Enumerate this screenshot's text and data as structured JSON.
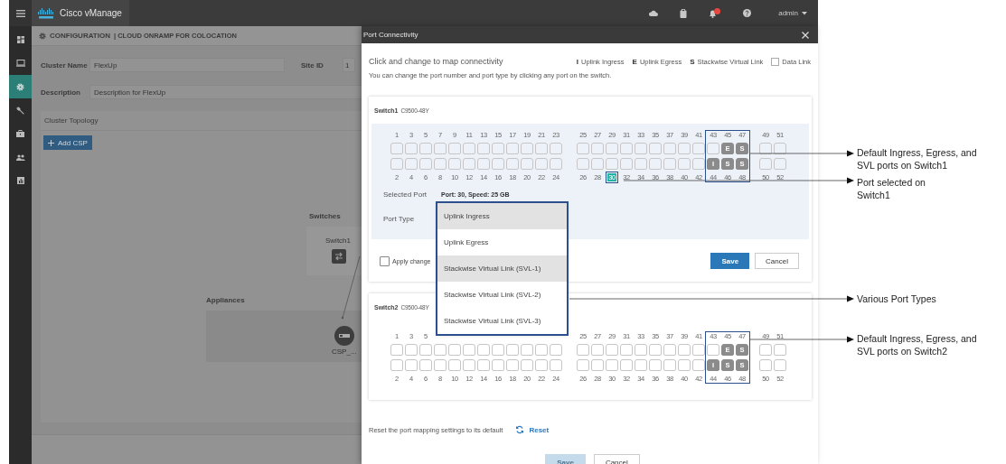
{
  "app": {
    "brand": "Cisco vManage",
    "user": "admin",
    "breadcrumb": {
      "section": "CONFIGURATION",
      "page": "| CLOUD ONRAMP FOR COLOCATION"
    },
    "sidebar": [
      {
        "kind": "dashboard",
        "selected": false
      },
      {
        "kind": "monitor",
        "selected": false
      },
      {
        "kind": "gear",
        "selected": true
      },
      {
        "kind": "wrench",
        "selected": false
      },
      {
        "kind": "toolbox",
        "selected": false
      },
      {
        "kind": "users",
        "selected": false
      },
      {
        "kind": "chart",
        "selected": false
      }
    ],
    "form": {
      "cluster_name_label": "Cluster Name",
      "cluster_name": "FlexUp",
      "site_id_label": "Site ID",
      "site_id": "1",
      "description_label": "Description",
      "description": "Description for FlexUp"
    },
    "topology": {
      "title": "Cluster Topology",
      "add_button": "Add CSP",
      "switches_title": "Switches",
      "switch_node": "Switch1",
      "appliances_title": "Appliances",
      "appliance_node": "CSP_..."
    }
  },
  "modal": {
    "title": "Port Connectivity",
    "heading": "Click and change to map connectivity",
    "hint": "You can change the port number and port type by clicking any port on the switch.",
    "legend": [
      {
        "kind": "ingress",
        "letter": "I",
        "label": "Uplink Ingress"
      },
      {
        "kind": "egress",
        "letter": "E",
        "label": "Uplink Egress"
      },
      {
        "kind": "svl",
        "letter": "S",
        "label": "Stackwise Virtual Link"
      },
      {
        "kind": "data",
        "label": "Data Link"
      }
    ],
    "switches": [
      {
        "name": "Switch1",
        "model": "C9500-48Y",
        "selected": true,
        "sections": [
          {
            "highlighted": false,
            "ports": [
              {
                "number": "1",
                "kind": "data",
                "selected": false
              },
              {
                "number": "2",
                "kind": "data",
                "selected": false
              },
              {
                "number": "3",
                "kind": "data",
                "selected": false
              },
              {
                "number": "4",
                "kind": "data",
                "selected": false
              },
              {
                "number": "5",
                "kind": "data",
                "selected": false
              },
              {
                "number": "6",
                "kind": "data",
                "selected": false
              },
              {
                "number": "7",
                "kind": "data",
                "selected": false
              },
              {
                "number": "8",
                "kind": "data",
                "selected": false
              },
              {
                "number": "9",
                "kind": "data",
                "selected": false
              },
              {
                "number": "10",
                "kind": "data",
                "selected": false
              },
              {
                "number": "11",
                "kind": "data",
                "selected": false
              },
              {
                "number": "12",
                "kind": "data",
                "selected": false
              },
              {
                "number": "13",
                "kind": "data",
                "selected": false
              },
              {
                "number": "14",
                "kind": "data",
                "selected": false
              },
              {
                "number": "15",
                "kind": "data",
                "selected": false
              },
              {
                "number": "16",
                "kind": "data",
                "selected": false
              },
              {
                "number": "17",
                "kind": "data",
                "selected": false
              },
              {
                "number": "18",
                "kind": "data",
                "selected": false
              },
              {
                "number": "19",
                "kind": "data",
                "selected": false
              },
              {
                "number": "20",
                "kind": "data",
                "selected": false
              },
              {
                "number": "21",
                "kind": "data",
                "selected": false
              },
              {
                "number": "22",
                "kind": "data",
                "selected": false
              },
              {
                "number": "23",
                "kind": "data",
                "selected": false
              },
              {
                "number": "24",
                "kind": "data",
                "selected": false
              }
            ]
          },
          {
            "highlighted": false,
            "ports": [
              {
                "number": "25",
                "kind": "data",
                "selected": false
              },
              {
                "number": "26",
                "kind": "data",
                "selected": false
              },
              {
                "number": "27",
                "kind": "data",
                "selected": false
              },
              {
                "number": "28",
                "kind": "data",
                "selected": false
              },
              {
                "number": "29",
                "kind": "data",
                "selected": false
              },
              {
                "number": "30",
                "kind": "data",
                "selected": true
              },
              {
                "number": "31",
                "kind": "data",
                "selected": false
              },
              {
                "number": "32",
                "kind": "data",
                "selected": false
              },
              {
                "number": "33",
                "kind": "data",
                "selected": false
              },
              {
                "number": "34",
                "kind": "data",
                "selected": false
              },
              {
                "number": "35",
                "kind": "data",
                "selected": false
              },
              {
                "number": "36",
                "kind": "data",
                "selected": false
              },
              {
                "number": "37",
                "kind": "data",
                "selected": false
              },
              {
                "number": "38",
                "kind": "data",
                "selected": false
              },
              {
                "number": "39",
                "kind": "data",
                "selected": false
              },
              {
                "number": "40",
                "kind": "data",
                "selected": false
              },
              {
                "number": "41",
                "kind": "data",
                "selected": false
              },
              {
                "number": "42",
                "kind": "data",
                "selected": false
              }
            ]
          },
          {
            "highlighted": true,
            "ports": [
              {
                "number": "43",
                "kind": "data",
                "selected": false
              },
              {
                "number": "44",
                "kind": "ingress",
                "letter": "I",
                "selected": false
              },
              {
                "number": "45",
                "kind": "egress",
                "letter": "E",
                "selected": false
              },
              {
                "number": "46",
                "kind": "svl",
                "letter": "S",
                "selected": false
              },
              {
                "number": "47",
                "kind": "svl",
                "letter": "S",
                "selected": false
              },
              {
                "number": "48",
                "kind": "svl",
                "letter": "S",
                "selected": false
              }
            ]
          },
          {
            "highlighted": false,
            "ports": [
              {
                "number": "49",
                "kind": "data",
                "selected": false
              },
              {
                "number": "50",
                "kind": "data",
                "selected": false
              },
              {
                "number": "51",
                "kind": "data",
                "selected": false
              },
              {
                "number": "52",
                "kind": "data",
                "selected": false
              }
            ]
          }
        ],
        "selected_port_label": "Selected Port",
        "selected_port": "Port: 30, Speed: 25 GB",
        "port_type_label": "Port Type",
        "apply_label": "Apply change",
        "apply_checked": false,
        "save": "Save",
        "cancel": "Cancel"
      },
      {
        "name": "Switch2",
        "model": "C9500-48Y",
        "selected": false,
        "sections": [
          {
            "highlighted": false,
            "ports": [
              {
                "number": "1",
                "kind": "data",
                "selected": false
              },
              {
                "number": "2",
                "kind": "data",
                "selected": false
              },
              {
                "number": "3",
                "kind": "data",
                "selected": false
              },
              {
                "number": "4",
                "kind": "data",
                "selected": false
              },
              {
                "number": "5",
                "kind": "data",
                "selected": false
              },
              {
                "number": "6",
                "kind": "data",
                "selected": false
              },
              {
                "kind": "data"
              },
              {
                "number": "8",
                "kind": "data",
                "selected": false
              },
              {
                "kind": "data"
              },
              {
                "number": "10",
                "kind": "data",
                "selected": false
              },
              {
                "kind": "data"
              },
              {
                "number": "12",
                "kind": "data",
                "selected": false
              },
              {
                "kind": "data"
              },
              {
                "number": "14",
                "kind": "data",
                "selected": false
              },
              {
                "kind": "data"
              },
              {
                "number": "16",
                "kind": "data",
                "selected": false
              },
              {
                "kind": "data"
              },
              {
                "number": "18",
                "kind": "data",
                "selected": false
              },
              {
                "kind": "data"
              },
              {
                "number": "20",
                "kind": "data",
                "selected": false
              },
              {
                "kind": "data"
              },
              {
                "number": "22",
                "kind": "data",
                "selected": false
              },
              {
                "kind": "data"
              },
              {
                "number": "24",
                "kind": "data",
                "selected": false
              }
            ]
          },
          {
            "highlighted": false,
            "ports": [
              {
                "number": "25",
                "kind": "data",
                "selected": false
              },
              {
                "number": "26",
                "kind": "data",
                "selected": false
              },
              {
                "number": "27",
                "kind": "data",
                "selected": false
              },
              {
                "number": "28",
                "kind": "data",
                "selected": false
              },
              {
                "number": "29",
                "kind": "data",
                "selected": false
              },
              {
                "number": "30",
                "kind": "data",
                "selected": false
              },
              {
                "number": "31",
                "kind": "data",
                "selected": false
              },
              {
                "number": "32",
                "kind": "data",
                "selected": false
              },
              {
                "number": "33",
                "kind": "data",
                "selected": false
              },
              {
                "number": "34",
                "kind": "data",
                "selected": false
              },
              {
                "number": "35",
                "kind": "data",
                "selected": false
              },
              {
                "number": "36",
                "kind": "data",
                "selected": false
              },
              {
                "number": "37",
                "kind": "data",
                "selected": false
              },
              {
                "number": "38",
                "kind": "data",
                "selected": false
              },
              {
                "number": "39",
                "kind": "data",
                "selected": false
              },
              {
                "number": "40",
                "kind": "data",
                "selected": false
              },
              {
                "number": "41",
                "kind": "data",
                "selected": false
              },
              {
                "number": "42",
                "kind": "data",
                "selected": false
              }
            ]
          },
          {
            "highlighted": true,
            "ports": [
              {
                "number": "43",
                "kind": "data",
                "selected": false
              },
              {
                "number": "44",
                "kind": "ingress",
                "letter": "I",
                "selected": false
              },
              {
                "number": "45",
                "kind": "egress",
                "letter": "E",
                "selected": false
              },
              {
                "number": "46",
                "kind": "svl",
                "letter": "S",
                "selected": false
              },
              {
                "number": "47",
                "kind": "svl",
                "letter": "S",
                "selected": false
              },
              {
                "number": "48",
                "kind": "svl",
                "letter": "S",
                "selected": false
              }
            ]
          },
          {
            "highlighted": false,
            "ports": [
              {
                "number": "49",
                "kind": "data",
                "selected": false
              },
              {
                "number": "50",
                "kind": "data",
                "selected": false
              },
              {
                "number": "51",
                "kind": "data",
                "selected": false
              },
              {
                "number": "52",
                "kind": "data",
                "selected": false
              }
            ]
          }
        ]
      }
    ],
    "port_type_menu": {
      "highlighted": true,
      "options": [
        {
          "label": "Uplink Ingress",
          "highlighted": true
        },
        {
          "label": "Uplink Egress",
          "highlighted": false
        },
        {
          "label": "Stackwise Virtual Link (SVL-1)",
          "highlighted": true
        },
        {
          "label": "Stackwise Virtual Link (SVL-2)",
          "highlighted": false
        },
        {
          "label": "Stackwise Virtual Link (SVL-3)",
          "highlighted": false
        }
      ]
    },
    "reset_hint": "Reset the port mapping settings to its default",
    "reset": "Reset",
    "save": "Save",
    "save_disabled": true,
    "cancel": "Cancel"
  },
  "callouts": [
    {
      "text": "Default Ingress, Egress, and\nSVL ports on Switch1"
    },
    {
      "text": "Port selected on\nSwitch1"
    },
    {
      "text": "Various Port Types"
    },
    {
      "text": "Default Ingress, Egress, and\nSVL ports on Switch2"
    }
  ]
}
